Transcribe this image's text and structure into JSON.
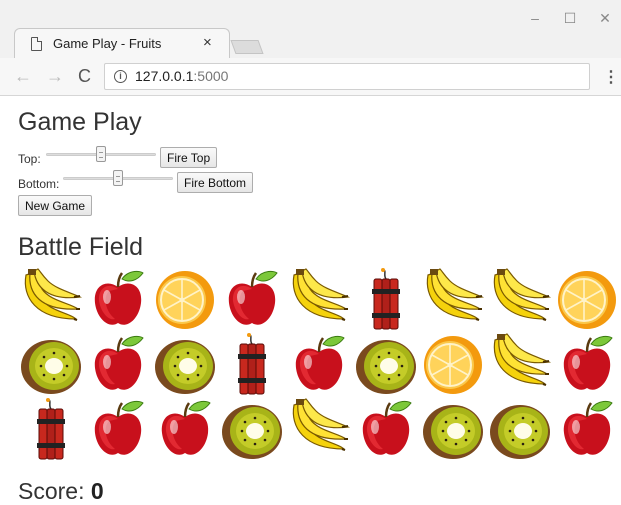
{
  "browser": {
    "tab_title": "Game Play - Fruits",
    "tab_close": "×",
    "url_host": "127.0.0.1",
    "url_port": ":5000",
    "back": "←",
    "forward": "→",
    "reload": "C",
    "menu": "⋮",
    "minimize": "–",
    "maximize": "☐",
    "close": "✕",
    "info": "i"
  },
  "game": {
    "heading": "Game Play",
    "top_label": "Top:",
    "top_slider_value": 0.5,
    "fire_top_label": "Fire Top",
    "bottom_label": "Bottom:",
    "bottom_slider_value": 0.5,
    "fire_bottom_label": "Fire Bottom",
    "new_game_label": "New Game"
  },
  "battlefield": {
    "heading": "Battle Field",
    "rows": [
      [
        "banana",
        "apple",
        "orange",
        "apple",
        "banana",
        "dynamite",
        "banana",
        "banana",
        "orange"
      ],
      [
        "kiwi",
        "apple",
        "kiwi",
        "dynamite",
        "apple",
        "kiwi",
        "orange",
        "banana",
        "apple"
      ],
      [
        "dynamite",
        "apple",
        "apple",
        "kiwi",
        "banana",
        "apple",
        "kiwi",
        "kiwi",
        "apple"
      ]
    ]
  },
  "score": {
    "label": "Score:",
    "value": "0"
  }
}
